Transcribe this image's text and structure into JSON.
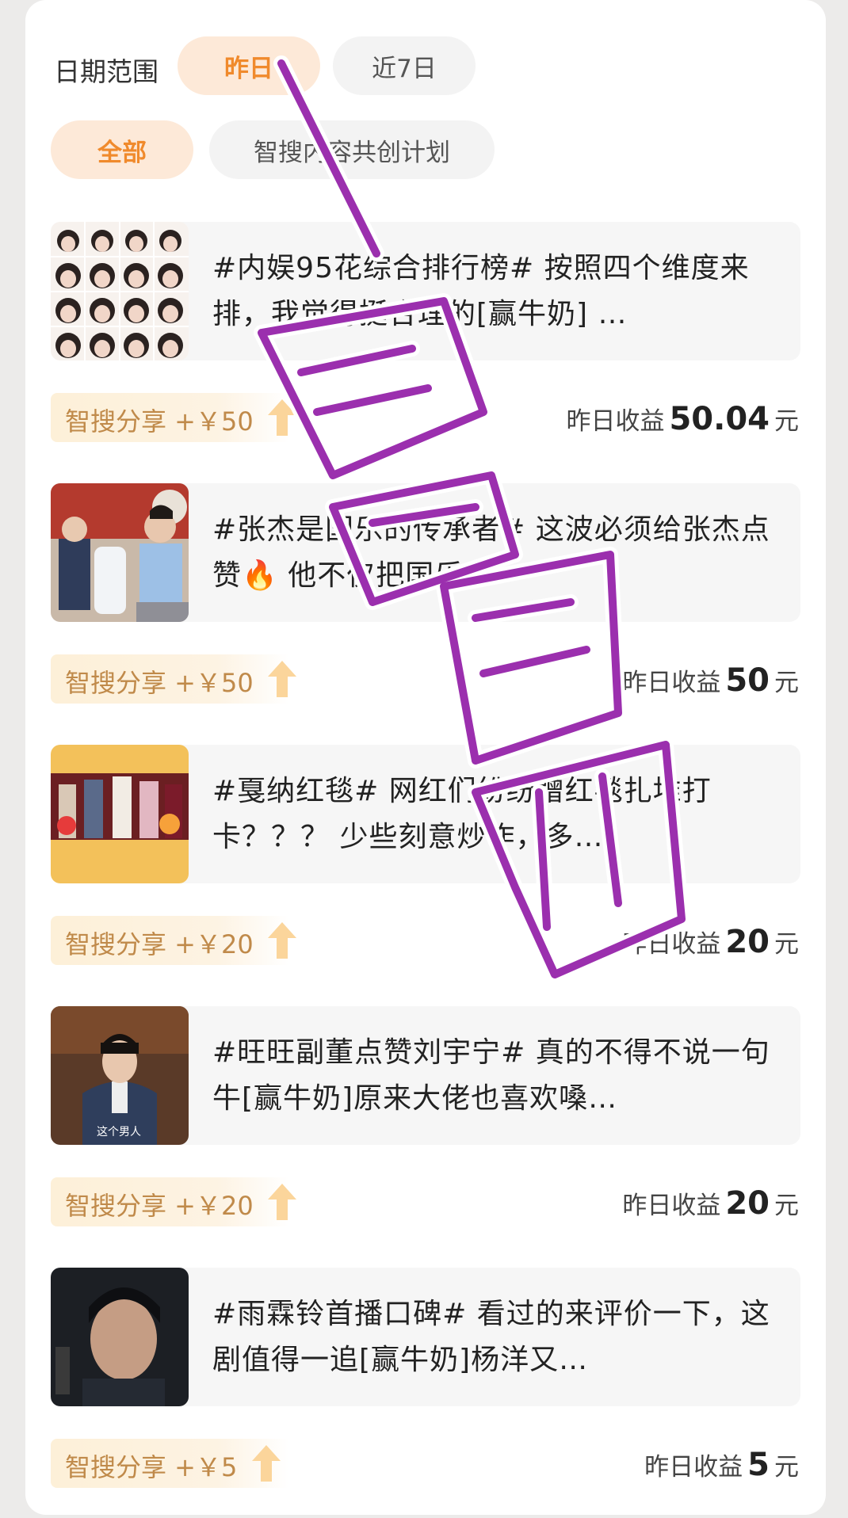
{
  "filters": {
    "date_range_label": "日期范围",
    "date_options": [
      "昨日",
      "近7日"
    ],
    "category_options": [
      "全部",
      "智搜内容共创计划"
    ]
  },
  "posts": [
    {
      "text": "#内娱95花综合排行榜# 按照四个维度来排，我觉得挺合理的[赢牛奶] …",
      "reward": "智搜分享 +￥50",
      "earn_label": "昨日收益",
      "earn_value": "50.04",
      "earn_unit": "元"
    },
    {
      "text": "#张杰是国乐的传承者# 这波必须给张杰点赞🔥 他不仅把国乐…",
      "reward": "智搜分享 +￥50",
      "earn_label": "昨日收益",
      "earn_value": "50",
      "earn_unit": "元"
    },
    {
      "text": "#戛纳红毯# 网红们纷纷蹭红毯扎堆打卡？？？ 少些刻意炒作，多…",
      "reward": "智搜分享 +￥20",
      "earn_label": "昨日收益",
      "earn_value": "20",
      "earn_unit": "元"
    },
    {
      "text": "#旺旺副董点赞刘宇宁# 真的不得不说一句牛[赢牛奶]原来大佬也喜欢嗓…",
      "reward": "智搜分享 +￥20",
      "earn_label": "昨日收益",
      "earn_value": "20",
      "earn_unit": "元"
    },
    {
      "text": "#雨霖铃首播口碑# 看过的来评价一下，这剧值得一追[赢牛奶]杨洋又…",
      "reward": "智搜分享 +￥5",
      "earn_label": "昨日收益",
      "earn_value": "5",
      "earn_unit": "元"
    }
  ],
  "thumb_captions": {
    "post4": "这个男人"
  },
  "watermark": "一週一ㄟ搬家記",
  "colors": {
    "accent": "#f08a2c",
    "reward_text": "#c08a4a",
    "watermark": "#9b2fae"
  }
}
